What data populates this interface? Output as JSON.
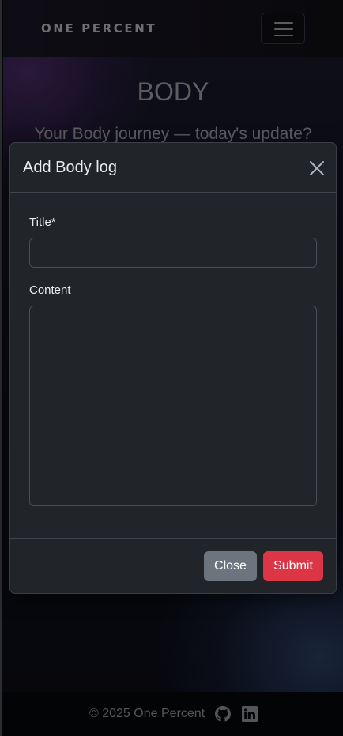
{
  "navbar": {
    "brand": "ONE PERCENT",
    "menu_icon": "hamburger-menu-icon"
  },
  "hero": {
    "title": "BODY",
    "subtitle": "Your Body journey — today's update?"
  },
  "modal": {
    "title": "Add Body log",
    "close_icon": "close-x-icon",
    "fields": {
      "title_label": "Title*",
      "title_value": "",
      "content_label": "Content",
      "content_value": ""
    },
    "buttons": {
      "close_label": "Close",
      "submit_label": "Submit"
    }
  },
  "footer": {
    "copyright": "© 2025 One Percent",
    "icons": [
      "github-icon",
      "linkedin-icon"
    ]
  },
  "colors": {
    "submit": "#dc3545",
    "close": "#6c757d",
    "modal_bg": "#212529"
  }
}
